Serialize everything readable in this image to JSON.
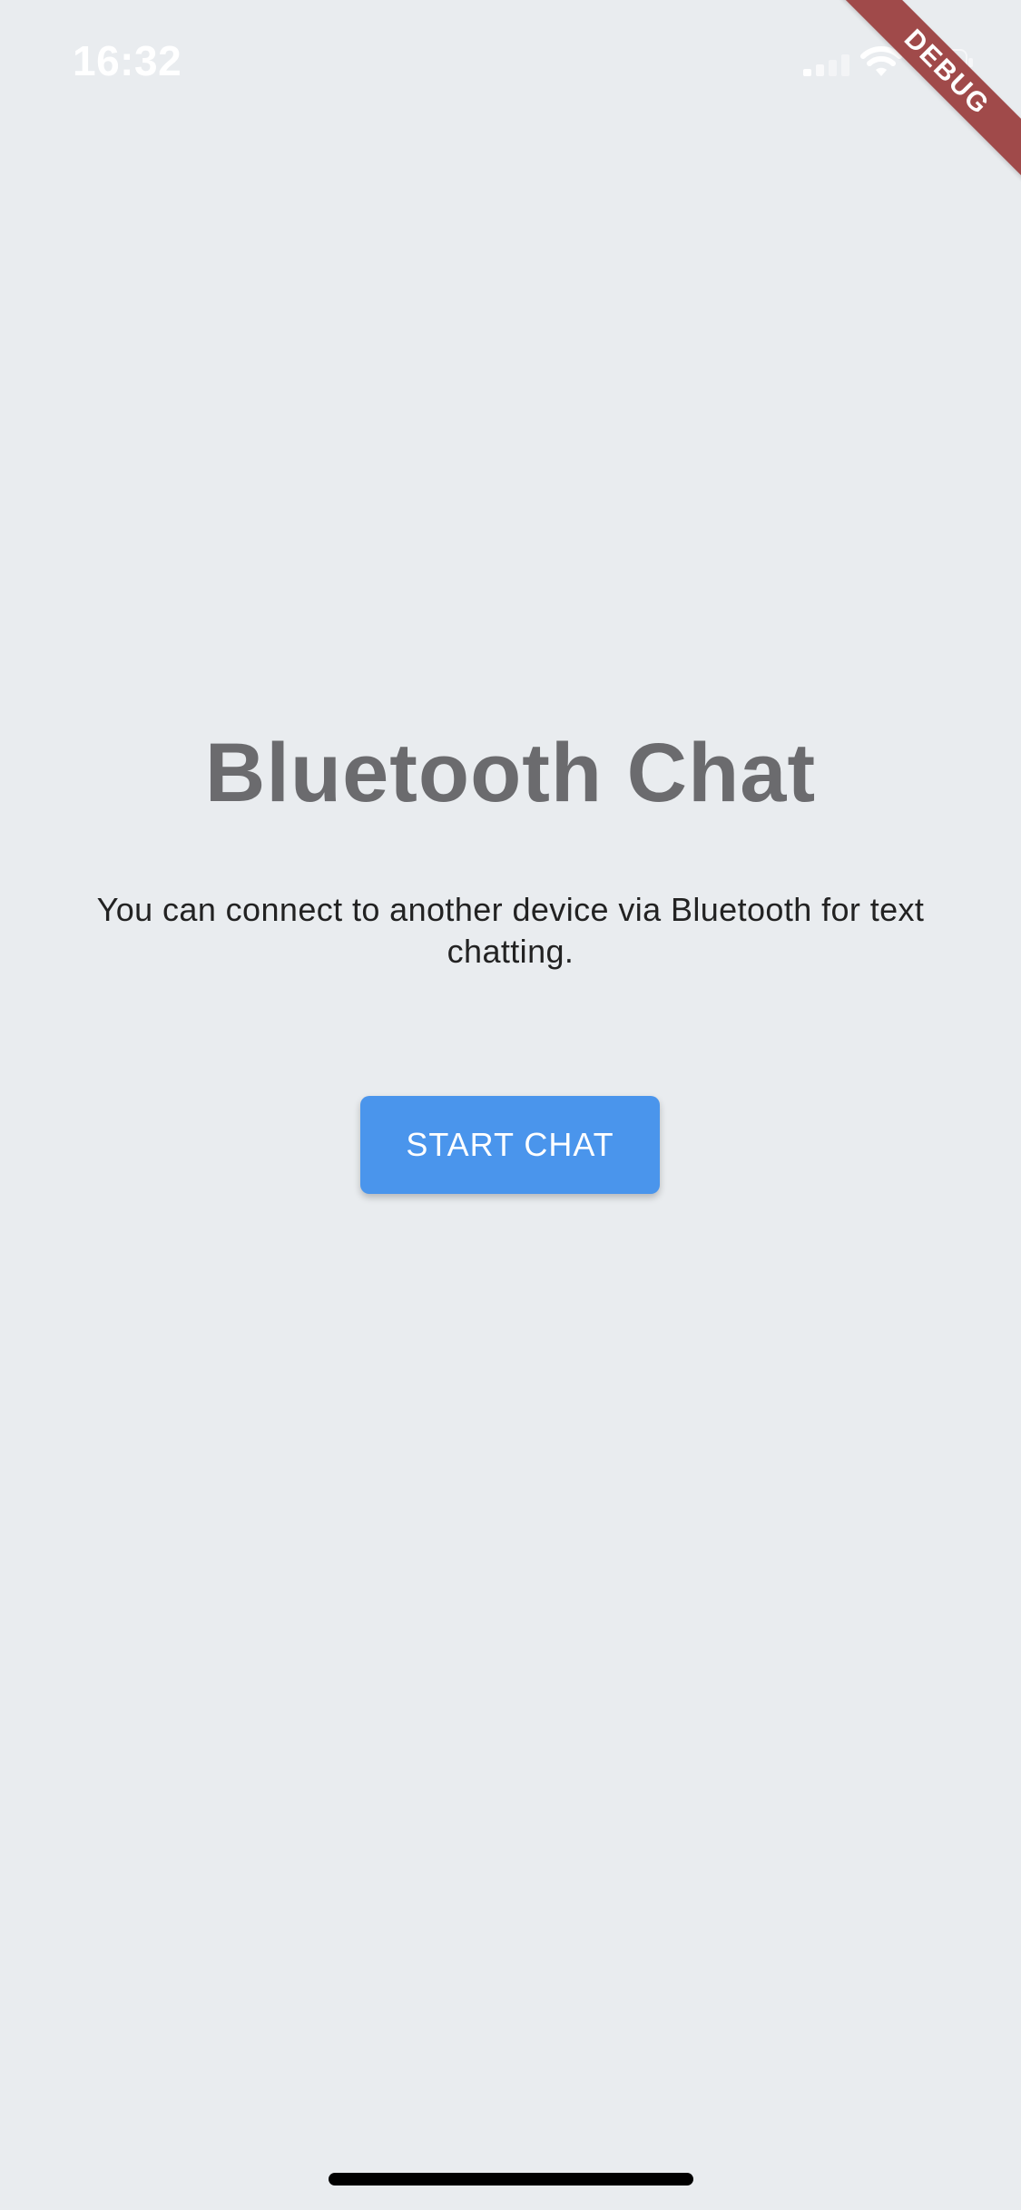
{
  "status_bar": {
    "time": "16:32",
    "icons": [
      "cellular-signal-icon",
      "wifi-icon",
      "battery-charging-icon"
    ]
  },
  "debug_banner": {
    "label": "DEBUG",
    "color": "#a04a4a"
  },
  "main": {
    "title": "Bluetooth Chat",
    "description": "You can connect to another device via Bluetooth for text chatting.",
    "start_button_label": "START CHAT"
  },
  "colors": {
    "background": "#e9ecef",
    "accent": "#4a95ec",
    "title_text": "#6b6b6e"
  }
}
